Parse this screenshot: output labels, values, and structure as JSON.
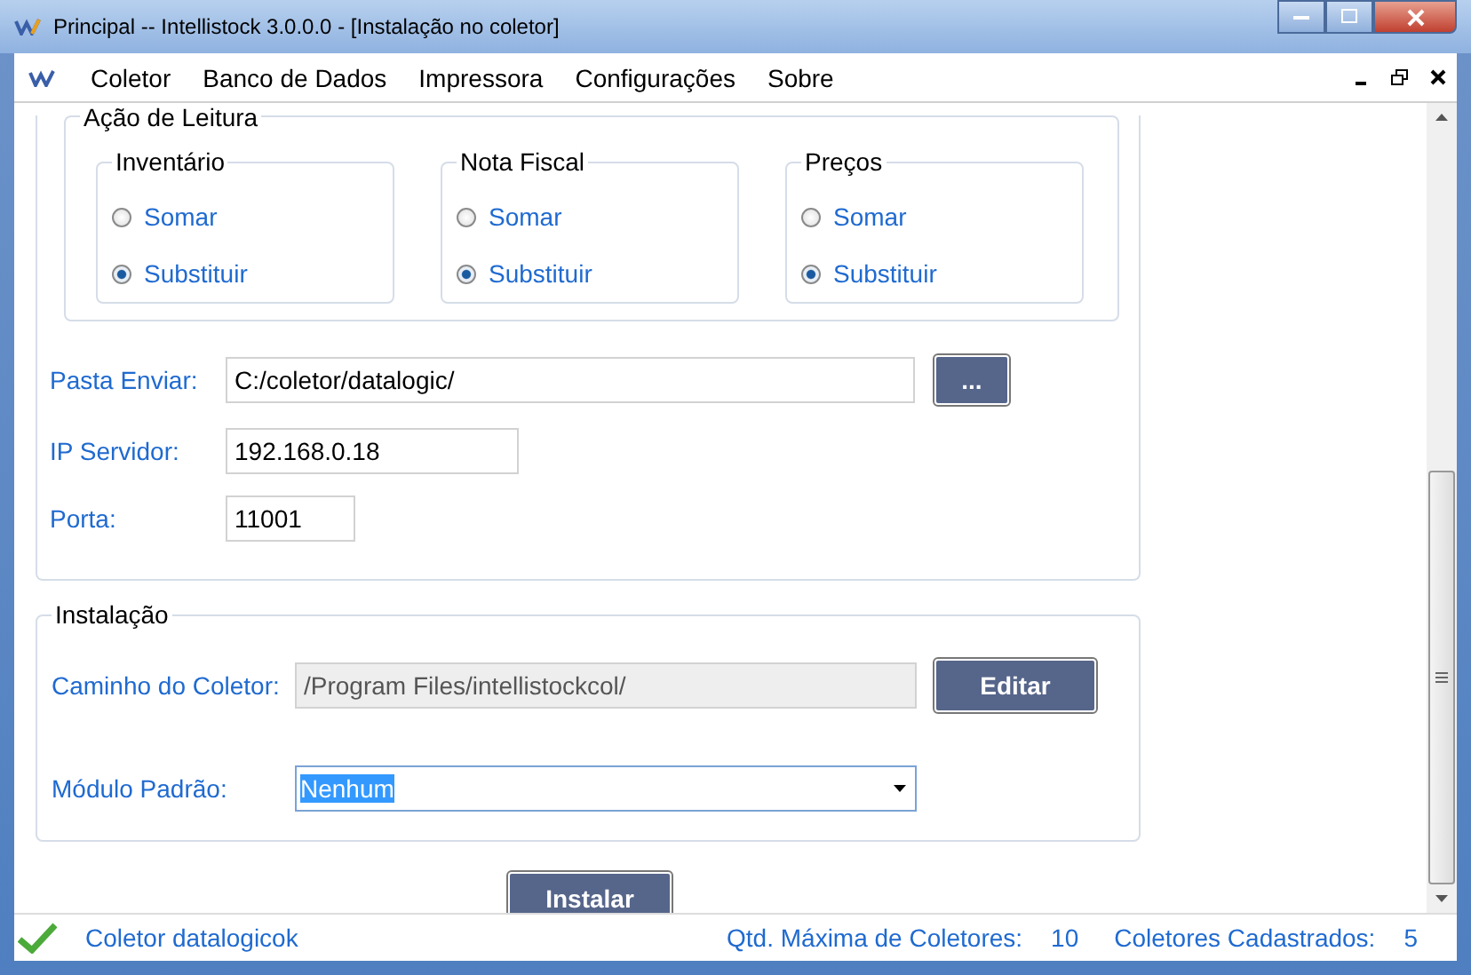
{
  "window": {
    "title": "Principal -- Intellistock 3.0.0.0 - [Instalação no coletor]"
  },
  "menu": [
    "Coletor",
    "Banco de Dados",
    "Impressora",
    "Configurações",
    "Sobre"
  ],
  "leitura": {
    "title": "Ação de Leitura",
    "groups": [
      {
        "title": "Inventário",
        "options": [
          {
            "label": "Somar",
            "selected": false
          },
          {
            "label": "Substituir",
            "selected": true
          }
        ]
      },
      {
        "title": "Nota Fiscal",
        "options": [
          {
            "label": "Somar",
            "selected": false
          },
          {
            "label": "Substituir",
            "selected": true
          }
        ]
      },
      {
        "title": "Preços",
        "options": [
          {
            "label": "Somar",
            "selected": false
          },
          {
            "label": "Substituir",
            "selected": true
          }
        ]
      }
    ]
  },
  "pasta_enviar": {
    "label": "Pasta Enviar:",
    "value": "C:/coletor/datalogic/",
    "button": "..."
  },
  "ip_servidor": {
    "label": "IP Servidor:",
    "value": "192.168.0.18"
  },
  "porta": {
    "label": "Porta:",
    "value": "11001"
  },
  "instalacao": {
    "title": "Instalação",
    "caminho": {
      "label": "Caminho do Coletor:",
      "value": "/Program Files/intellistockcol/",
      "disabled": true,
      "button": "Editar"
    },
    "modulo": {
      "label": "Módulo Padrão:",
      "value": "Nenhum"
    }
  },
  "install_button": "Instalar",
  "status_bar": {
    "message": "Coletor datalogicok",
    "max_label": "Qtd. Máxima de Coletores:",
    "max_value": "10",
    "count_label": "Coletores Cadastrados:",
    "count_value": "5"
  }
}
